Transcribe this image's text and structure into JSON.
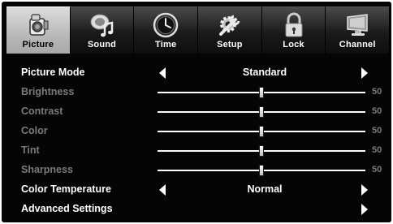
{
  "tabs": [
    {
      "label": "Picture",
      "icon": "camera-icon",
      "active": true
    },
    {
      "label": "Sound",
      "icon": "speaker-music-icon",
      "active": false
    },
    {
      "label": "Time",
      "icon": "clock-icon",
      "active": false
    },
    {
      "label": "Setup",
      "icon": "gear-wrench-icon",
      "active": false
    },
    {
      "label": "Lock",
      "icon": "padlock-icon",
      "active": false
    },
    {
      "label": "Channel",
      "icon": "monitor-icon",
      "active": false
    }
  ],
  "menu": {
    "picture_mode": {
      "label": "Picture Mode",
      "value": "Standard"
    },
    "brightness": {
      "label": "Brightness",
      "value": "50",
      "level": 0.5
    },
    "contrast": {
      "label": "Contrast",
      "value": "50",
      "level": 0.5
    },
    "color": {
      "label": "Color",
      "value": "50",
      "level": 0.5
    },
    "tint": {
      "label": "Tint",
      "value": "50",
      "level": 0.5
    },
    "sharpness": {
      "label": "Sharpness",
      "value": "50",
      "level": 0.5
    },
    "color_temperature": {
      "label": "Color Temperature",
      "value": "Normal"
    },
    "advanced_settings": {
      "label": "Advanced Settings"
    }
  },
  "colors": {
    "background": "#050505",
    "active_tab": "#c8c8c8",
    "text": "#ffffff",
    "dim_text": "#7a7a7a"
  }
}
